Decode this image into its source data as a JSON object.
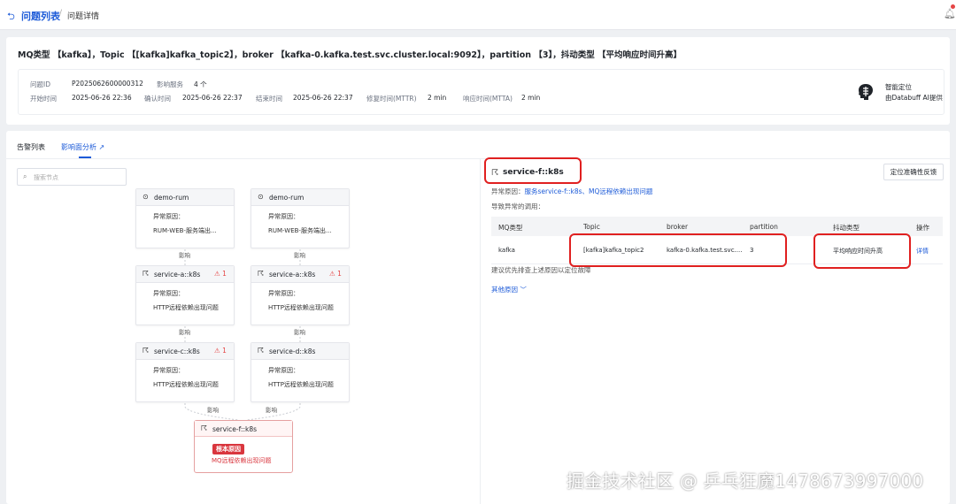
{
  "topbar": {
    "back_icon": "back-arrow-icon",
    "crumb_list": "问题列表",
    "crumb_sep": "/",
    "crumb_detail": "问题详情",
    "bell_icon": "bell-icon"
  },
  "problem": {
    "title": "MQ类型 【kafka】，Topic 【[kafka]kafka_topic2】，broker 【kafka-0.kafka.test.svc.cluster.local:9092】，partition 【3】，抖动类型 【平均响应时间升高】",
    "meta": {
      "id_label": "问题ID",
      "id_value": "P2025062600000312",
      "svc_label": "影响服务",
      "svc_value": "4 个",
      "start_label": "开始时间",
      "start_value": "2025-06-26 22:36",
      "confirm_label": "确认时间",
      "confirm_value": "2025-06-26 22:37",
      "end_label": "结束时间",
      "end_value": "2025-06-26 22:37",
      "mttr_label": "修复时间(MTTR)",
      "mttr_value": "2 min",
      "mtta_label": "响应时间(MTTA)",
      "mtta_value": "2 min"
    },
    "smart": {
      "line1": "智能定位",
      "line2": "由Databuff AI提供"
    }
  },
  "tabs": [
    {
      "label": "告警列表",
      "active": false
    },
    {
      "label": "影响面分析",
      "active": true
    }
  ],
  "search": {
    "placeholder": "搜索节点"
  },
  "graph": {
    "nodes": [
      {
        "title": "demo-rum",
        "alarm": "",
        "line1": "异常原因：",
        "line2": "RUM-WEB-服务端出..."
      },
      {
        "title": "demo-rum",
        "alarm": "",
        "line1": "异常原因：",
        "line2": "RUM-WEB-服务端出..."
      },
      {
        "title": "service-a::k8s",
        "alarm": "1",
        "line1": "异常原因：",
        "line2": "HTTP远程依赖出现问题"
      },
      {
        "title": "service-a::k8s",
        "alarm": "1",
        "line1": "异常原因：",
        "line2": "HTTP远程依赖出现问题"
      },
      {
        "title": "service-c::k8s",
        "alarm": "1",
        "line1": "异常原因：",
        "line2": "HTTP远程依赖出现问题"
      },
      {
        "title": "service-d::k8s",
        "alarm": "",
        "line1": "异常原因：",
        "line2": "HTTP远程依赖出现问题"
      }
    ],
    "edge_label": "影响",
    "root": {
      "title": "service-f::k8s",
      "badge": "根本原因",
      "desc": "MQ远程依赖出现问题"
    }
  },
  "detail": {
    "service": "service-f::k8s",
    "feedback_button": "定位准确性反馈",
    "cause_label": "异常原因：",
    "cause_link": "服务service-f::k8s、MQ远程依赖出现问题",
    "called_label": "导致异常的调用：",
    "columns": [
      "MQ类型",
      "Topic",
      "broker",
      "partition",
      "抖动类型",
      "操作"
    ],
    "row": [
      "kafka",
      "[kafka]kafka_topic2",
      "kafka-0.kafka.test.svc....",
      "3",
      "平均响应时间升高",
      "详情"
    ],
    "hint": "建议优先排查上述原因以定位故障",
    "other": "其他原因 ﹀"
  },
  "watermark": "掘金技术社区 @ 乒乓狂魔1478673997000",
  "colors": {
    "accent": "#1d5bd8",
    "alert": "#e54545",
    "root": "#d9363e",
    "highlight": "#e02020"
  }
}
